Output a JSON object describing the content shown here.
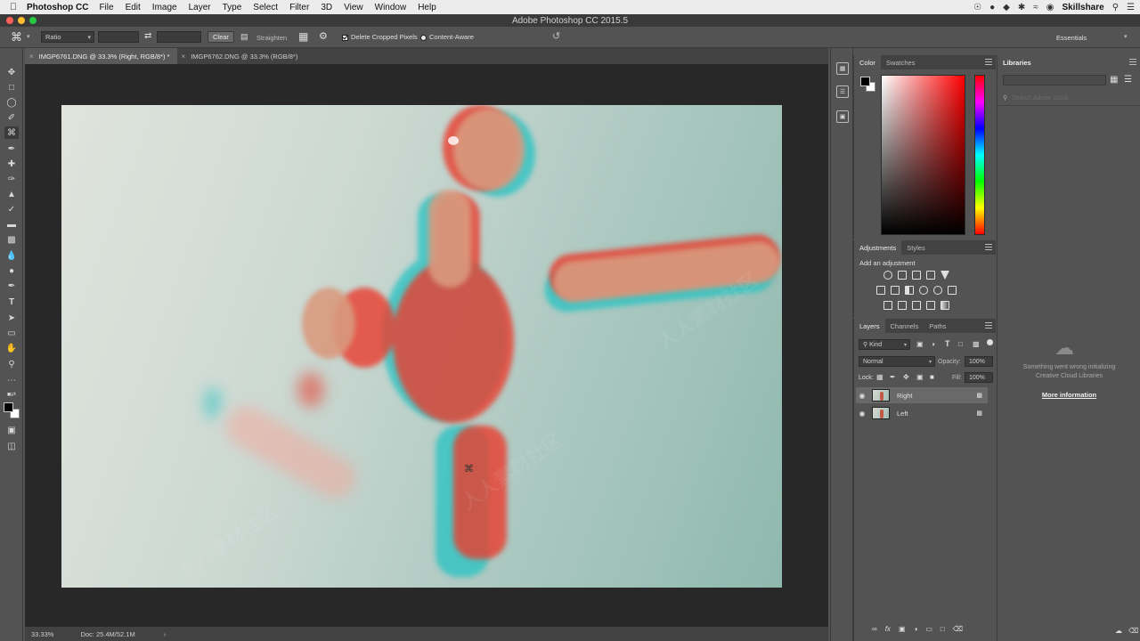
{
  "menubar": {
    "app_name": "Photoshop CC",
    "menus": [
      "File",
      "Edit",
      "Image",
      "Layer",
      "Type",
      "Select",
      "Filter",
      "3D",
      "View",
      "Window",
      "Help"
    ],
    "right_label": "Skillshare"
  },
  "window": {
    "title": "Adobe Photoshop CC 2015.5"
  },
  "options": {
    "ratio_value": "Ratio",
    "clear_label": "Clear",
    "straighten_label": "Straighten",
    "delete_cropped_label": "Delete Cropped Pixels",
    "content_aware_label": "Content-Aware",
    "workspace_label": "Essentials"
  },
  "doc_tabs": [
    {
      "label": "IMGP6761.DNG @ 33.3% (Right, RGB/8*) *",
      "active": true
    },
    {
      "label": "IMGP6762.DNG @ 33.3% (RGB/8*)",
      "active": false
    }
  ],
  "status": {
    "zoom": "33.33%",
    "doc_size": "Doc: 25.4M/52.1M"
  },
  "color_panel": {
    "tabs": [
      "Color",
      "Swatches"
    ],
    "foreground": "#000000",
    "background": "#ffffff"
  },
  "adjust_panel": {
    "tabs": [
      "Adjustments",
      "Styles"
    ],
    "heading": "Add an adjustment"
  },
  "layers_panel": {
    "tabs": [
      "Layers",
      "Channels",
      "Paths"
    ],
    "filter_kind": "Kind",
    "blend_mode": "Normal",
    "opacity_label": "Opacity:",
    "opacity_value": "100%",
    "lock_label": "Lock:",
    "fill_label": "Fill:",
    "fill_value": "100%",
    "layers": [
      {
        "name": "Right",
        "selected": true
      },
      {
        "name": "Left",
        "selected": false
      }
    ]
  },
  "libraries": {
    "title": "Libraries",
    "search_placeholder": "Search Adobe Stock",
    "error_line1": "Something went wrong initializing",
    "error_line2": "Creative Cloud Libraries",
    "more_info": "More information"
  },
  "colors": {
    "accent_red": "#e23b2e",
    "accent_cyan": "#1fc7c7",
    "panel_bg": "#535353"
  }
}
